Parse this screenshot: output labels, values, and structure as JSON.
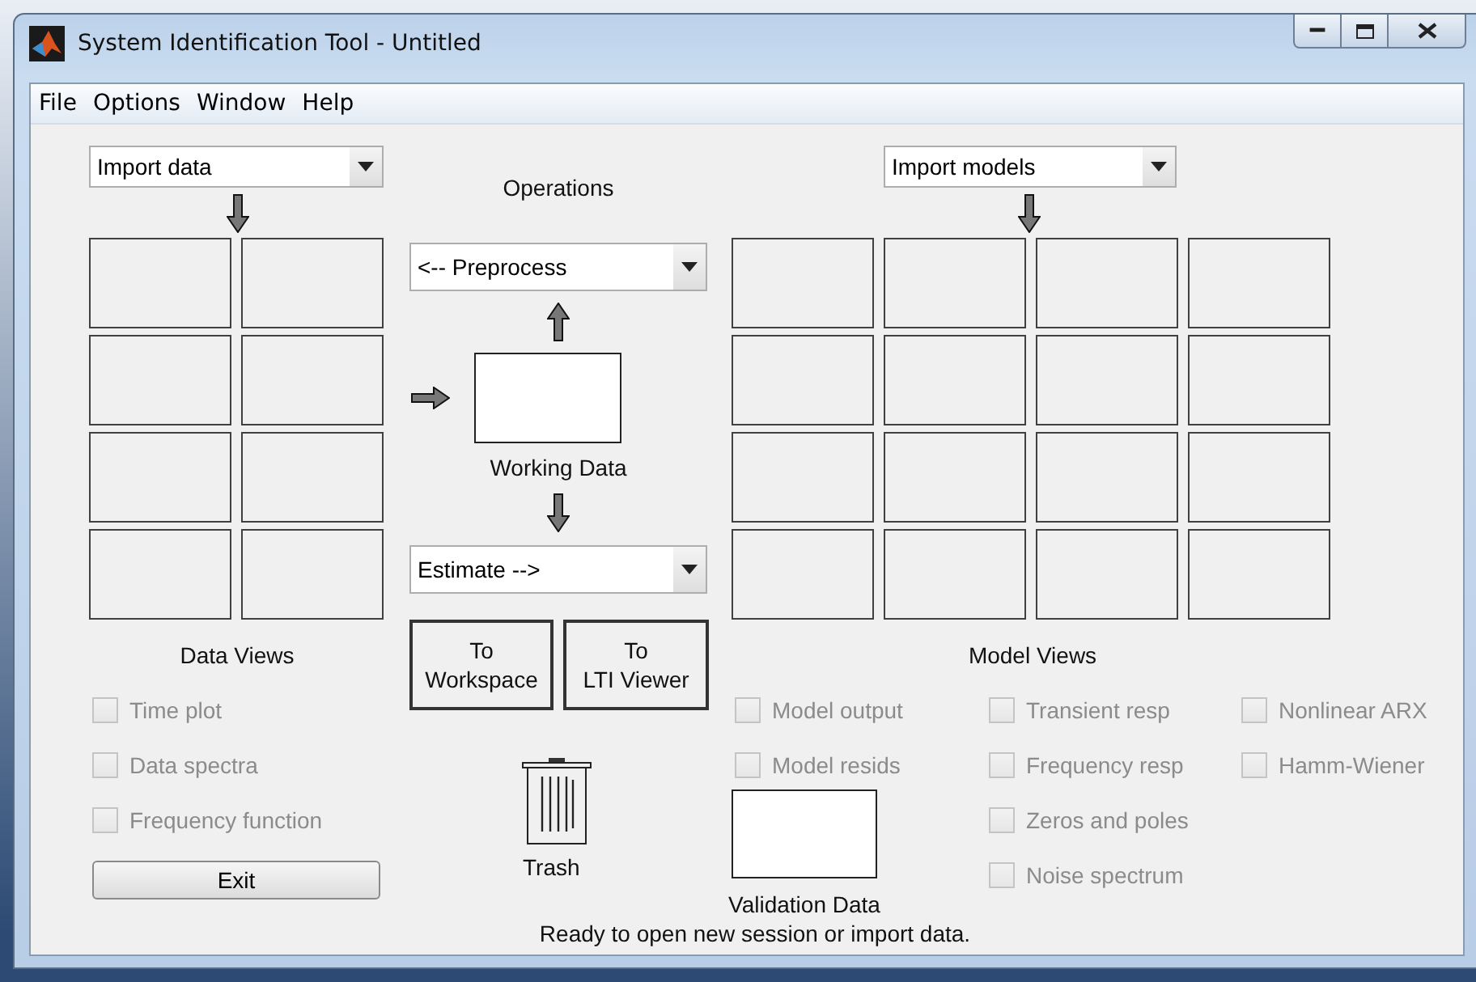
{
  "window": {
    "title": "System Identification Tool - Untitled"
  },
  "menu": [
    "File",
    "Options",
    "Window",
    "Help"
  ],
  "data_import": {
    "value": "Import data"
  },
  "operations": {
    "label": "Operations",
    "preprocess": "<-- Preprocess",
    "working_data": "Working Data",
    "estimate": "Estimate -->"
  },
  "export_buttons": [
    {
      "lines": [
        "To",
        "Workspace"
      ]
    },
    {
      "lines": [
        "To",
        "LTI Viewer"
      ]
    }
  ],
  "data_views": {
    "label": "Data Views",
    "options": [
      {
        "label": "Time plot",
        "checked": false,
        "disabled": true
      },
      {
        "label": "Data spectra",
        "checked": false,
        "disabled": true
      },
      {
        "label": "Frequency function",
        "checked": false,
        "disabled": true
      }
    ]
  },
  "exit_button": "Exit",
  "trash": "Trash",
  "model_import": {
    "value": "Import models"
  },
  "model_views": {
    "label": "Model Views",
    "columns": [
      [
        {
          "label": "Model output",
          "checked": false,
          "disabled": true
        },
        {
          "label": "Model resids",
          "checked": false,
          "disabled": true
        }
      ],
      [
        {
          "label": "Transient resp",
          "checked": false,
          "disabled": true
        },
        {
          "label": "Frequency resp",
          "checked": false,
          "disabled": true
        },
        {
          "label": "Zeros and poles",
          "checked": false,
          "disabled": true
        },
        {
          "label": "Noise spectrum",
          "checked": false,
          "disabled": true
        }
      ],
      [
        {
          "label": "Nonlinear ARX",
          "checked": false,
          "disabled": true
        },
        {
          "label": "Hamm-Wiener",
          "checked": false,
          "disabled": true
        }
      ]
    ]
  },
  "validation_data": "Validation Data",
  "status_bar": "Ready to open new session or import data."
}
